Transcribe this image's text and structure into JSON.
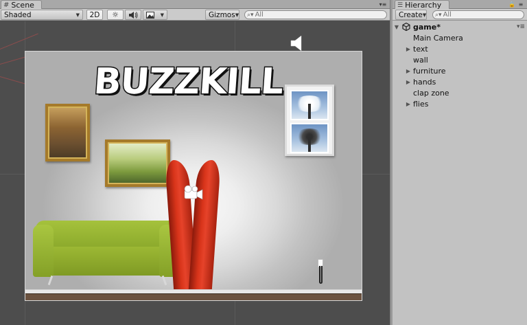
{
  "scene": {
    "tab_label": "Scene",
    "shading_mode": "Shaded",
    "mode_2d_label": "2D",
    "gizmos_label": "Gizmos",
    "search_placeholder": "All",
    "game_title_text": "BUZZKILL"
  },
  "hierarchy": {
    "tab_label": "Hierarchy",
    "create_label": "Create",
    "search_placeholder": "All",
    "root": {
      "label": "game*"
    },
    "items": [
      {
        "label": "Main Camera",
        "expandable": false
      },
      {
        "label": "text",
        "expandable": true
      },
      {
        "label": "wall",
        "expandable": false
      },
      {
        "label": "furniture",
        "expandable": true
      },
      {
        "label": "hands",
        "expandable": true
      },
      {
        "label": "clap zone",
        "expandable": false
      },
      {
        "label": "flies",
        "expandable": true
      }
    ]
  },
  "icons": {
    "scene_tab": "grid-icon",
    "lighting": "sun-icon",
    "audio": "speaker-icon",
    "effects": "image-icon",
    "hierarchy_tab": "list-icon",
    "lock": "lock-icon",
    "panel_menu": "menu-icon"
  },
  "colors": {
    "editor_bg": "#c2c2c2",
    "viewport_bg": "#4d4d4d",
    "couch_green": "#9cb834",
    "legs_red": "#d8341a",
    "frame_gold": "#a57a2a"
  }
}
